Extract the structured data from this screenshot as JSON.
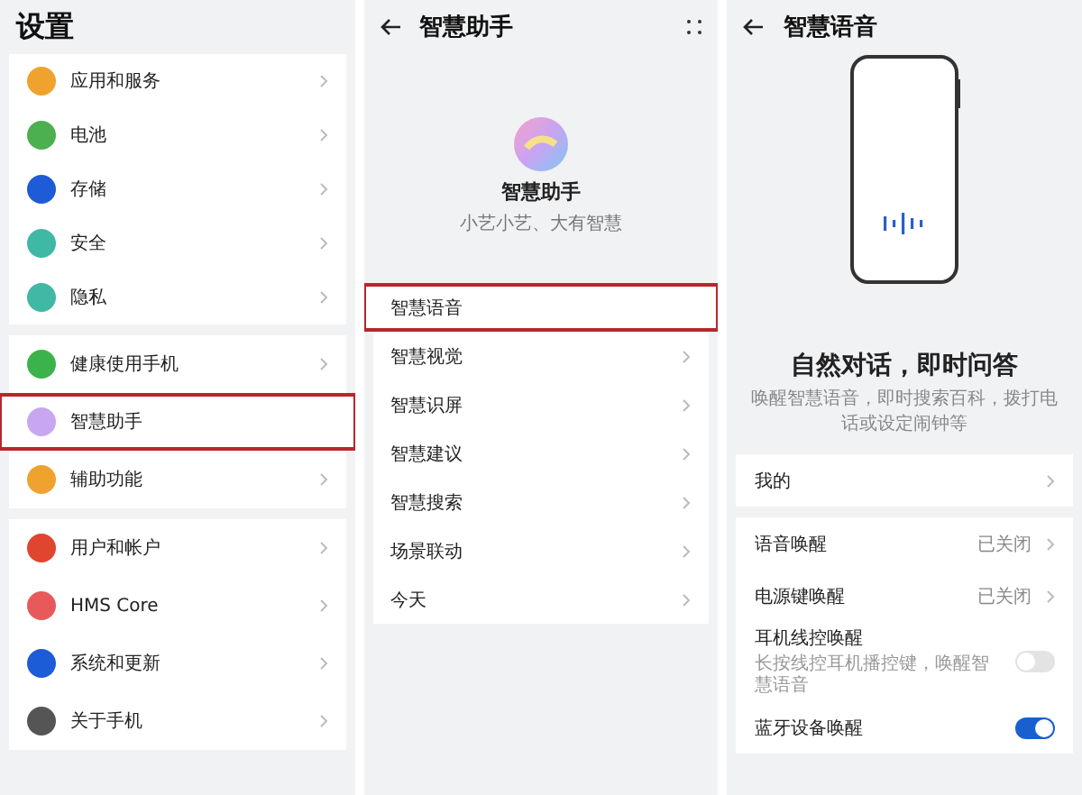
{
  "settings": {
    "title": "设置",
    "groups": [
      {
        "items": [
          {
            "label": "应用和服务",
            "color": "#f0a22e",
            "highlighted": false
          },
          {
            "label": "电池",
            "color": "#4caf50",
            "highlighted": false
          },
          {
            "label": "存储",
            "color": "#1e5bd6",
            "highlighted": false
          },
          {
            "label": "安全",
            "color": "#3fb8a6",
            "highlighted": false
          },
          {
            "label": "隐私",
            "color": "#3fb8a6",
            "highlighted": false
          }
        ]
      },
      {
        "items": [
          {
            "label": "健康使用手机",
            "color": "#3cb34a",
            "highlighted": false
          },
          {
            "label": "智慧助手",
            "color": "#c9a6f0",
            "highlighted": true
          },
          {
            "label": "辅助功能",
            "color": "#f0a22e",
            "highlighted": false
          }
        ]
      },
      {
        "items": [
          {
            "label": "用户和帐户",
            "color": "#e0452f",
            "highlighted": false
          },
          {
            "label": "HMS Core",
            "color": "#e85a5a",
            "highlighted": false
          },
          {
            "label": "系统和更新",
            "color": "#1e5bd6",
            "highlighted": false
          },
          {
            "label": "关于手机",
            "color": "#555555",
            "highlighted": false
          }
        ]
      }
    ]
  },
  "assistant": {
    "title": "智慧助手",
    "app_name": "智慧助手",
    "slogan": "小艺小艺、大有智慧",
    "items": [
      {
        "label": "智慧语音",
        "highlighted": true
      },
      {
        "label": "智慧视觉",
        "highlighted": false
      },
      {
        "label": "智慧识屏",
        "highlighted": false
      },
      {
        "label": "智慧建议",
        "highlighted": false
      },
      {
        "label": "智慧搜索",
        "highlighted": false
      },
      {
        "label": "场景联动",
        "highlighted": false
      },
      {
        "label": "今天",
        "highlighted": false
      }
    ]
  },
  "voice": {
    "title": "智慧语音",
    "headline": "自然对话，即时问答",
    "description": "唤醒智慧语音，即时搜索百科，拨打电话或设定闹钟等",
    "groups": [
      {
        "items": [
          {
            "kind": "link",
            "label": "我的"
          }
        ]
      },
      {
        "items": [
          {
            "kind": "link",
            "label": "语音唤醒",
            "value": "已关闭"
          },
          {
            "kind": "link",
            "label": "电源键唤醒",
            "value": "已关闭"
          },
          {
            "kind": "toggle",
            "label": "耳机线控唤醒",
            "sublabel": "长按线控耳机播控键，唤醒智慧语音",
            "on": false
          },
          {
            "kind": "toggle",
            "label": "蓝牙设备唤醒",
            "on": true
          }
        ]
      }
    ]
  }
}
